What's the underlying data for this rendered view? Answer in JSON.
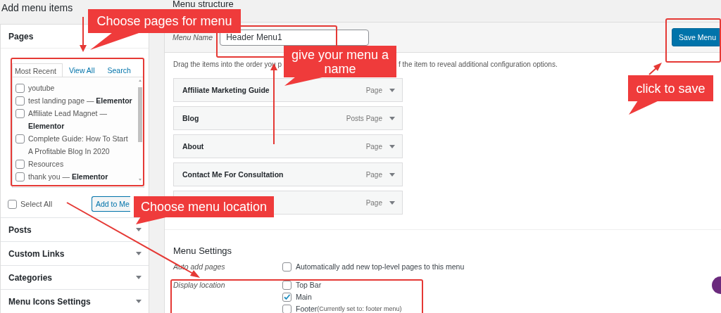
{
  "left_panel": {
    "title": "Add menu items",
    "sections": [
      {
        "title": "Pages",
        "expanded": true,
        "tabs": [
          {
            "label": "Most Recent",
            "selected": true
          },
          {
            "label": "View All",
            "selected": false
          },
          {
            "label": "Search",
            "selected": false
          }
        ],
        "items": [
          {
            "label": "youtube",
            "checked": false
          },
          {
            "label": "test landing page — **Elementor**",
            "checked": false
          },
          {
            "label": "Affiliate Lead Magnet — **Elementor**",
            "checked": false
          },
          {
            "label": "Complete Guide: How To Start A Profitable Blog In 2020",
            "checked": false
          },
          {
            "label": "Resources",
            "checked": false
          },
          {
            "label": "thank you — **Elementor**",
            "checked": false
          }
        ],
        "select_all": {
          "label": "Select All",
          "checked": false
        },
        "add_button": "Add to Me"
      },
      {
        "title": "Posts",
        "expanded": false
      },
      {
        "title": "Custom Links",
        "expanded": false
      },
      {
        "title": "Categories",
        "expanded": false
      },
      {
        "title": "Menu Icons Settings",
        "expanded": false
      }
    ]
  },
  "menu_structure": {
    "title": "Menu structure",
    "name_label": "Menu Name",
    "name_value": "Header Menu1",
    "save_button": "Save Menu",
    "instructions": [
      "Drag the items into the order you p",
      "f the item to reveal additional configuration options."
    ],
    "items": [
      {
        "title": "Affiliate Marketing Guide",
        "type": "Page"
      },
      {
        "title": "Blog",
        "type": "Posts Page"
      },
      {
        "title": "About",
        "type": "Page"
      },
      {
        "title": "Contact Me For Consultation",
        "type": "Page"
      },
      {
        "type": "Page"
      }
    ],
    "settings": {
      "title": "Menu Settings",
      "rows": [
        {
          "label": "Auto add pages",
          "options": [
            {
              "label": "Automatically add new top-level pages to this menu",
              "checked": false
            }
          ]
        },
        {
          "label": "Display location",
          "options": [
            {
              "label": "Top Bar",
              "checked": false
            },
            {
              "label": "Main",
              "checked": true
            },
            {
              "label": "Footer",
              "note": "(Currently set to: footer menu)",
              "checked": false
            }
          ]
        }
      ]
    }
  },
  "annotations": [
    {
      "text": "Choose pages for menu"
    },
    {
      "text": "give your menu a name"
    },
    {
      "text": "click to save"
    },
    {
      "text": "Choose menu location"
    }
  ]
}
